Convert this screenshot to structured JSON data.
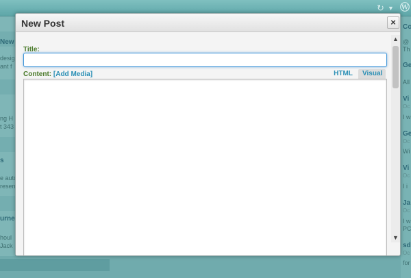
{
  "modal": {
    "title": "New Post",
    "close_label": "×",
    "title_label": "Title:",
    "title_value": "",
    "content_label": "Content:",
    "add_media_label": "[Add Media]",
    "tabs": [
      {
        "label": "HTML",
        "active": false
      },
      {
        "label": "Visual",
        "active": true
      }
    ],
    "content_value": ""
  },
  "scrollbar": {
    "up_icon": "▲",
    "down_icon": "▼"
  },
  "background": {
    "topbar_icons": [
      "refresh-icon",
      "chevron-down-icon",
      "wordpress-logo"
    ],
    "left_fragments": [
      {
        "text": "New",
        "bold": true
      },
      {
        "text": "desig",
        "bold": false
      },
      {
        "text": "ant f",
        "bold": false
      },
      {
        "text": "ng H",
        "bold": false
      },
      {
        "text": "t 343",
        "bold": false
      },
      {
        "text": "s",
        "bold": true
      },
      {
        "text": "e auto",
        "bold": false
      },
      {
        "text": "resen",
        "bold": false
      },
      {
        "text": "urne",
        "bold": true
      },
      {
        "text": "houl",
        "bold": false
      },
      {
        "text": "Jack",
        "bold": false
      }
    ],
    "right_fragments": [
      {
        "text": "Co",
        "kind": "bold"
      },
      {
        "text": "@",
        "kind": "text"
      },
      {
        "text": "Th",
        "kind": "text"
      },
      {
        "text": "Ge",
        "kind": "bold"
      },
      {
        "text": "All",
        "kind": "text"
      },
      {
        "text": "Vi",
        "kind": "bold"
      },
      {
        "text": "Oc",
        "kind": "date"
      },
      {
        "text": "I w",
        "kind": "text"
      },
      {
        "text": "Ge",
        "kind": "bold"
      },
      {
        "text": "Oc",
        "kind": "date"
      },
      {
        "text": "Wi",
        "kind": "text"
      },
      {
        "text": "Vi",
        "kind": "bold"
      },
      {
        "text": "Oc",
        "kind": "date"
      },
      {
        "text": "I i",
        "kind": "text"
      },
      {
        "text": "Ja",
        "kind": "bold"
      },
      {
        "text": "Oc",
        "kind": "date"
      },
      {
        "text": "I w",
        "kind": "text"
      },
      {
        "text": "PC",
        "kind": "text"
      },
      {
        "text": "sd",
        "kind": "bold"
      },
      {
        "text": "Oc",
        "kind": "date"
      },
      {
        "text": "for",
        "kind": "text"
      }
    ]
  }
}
